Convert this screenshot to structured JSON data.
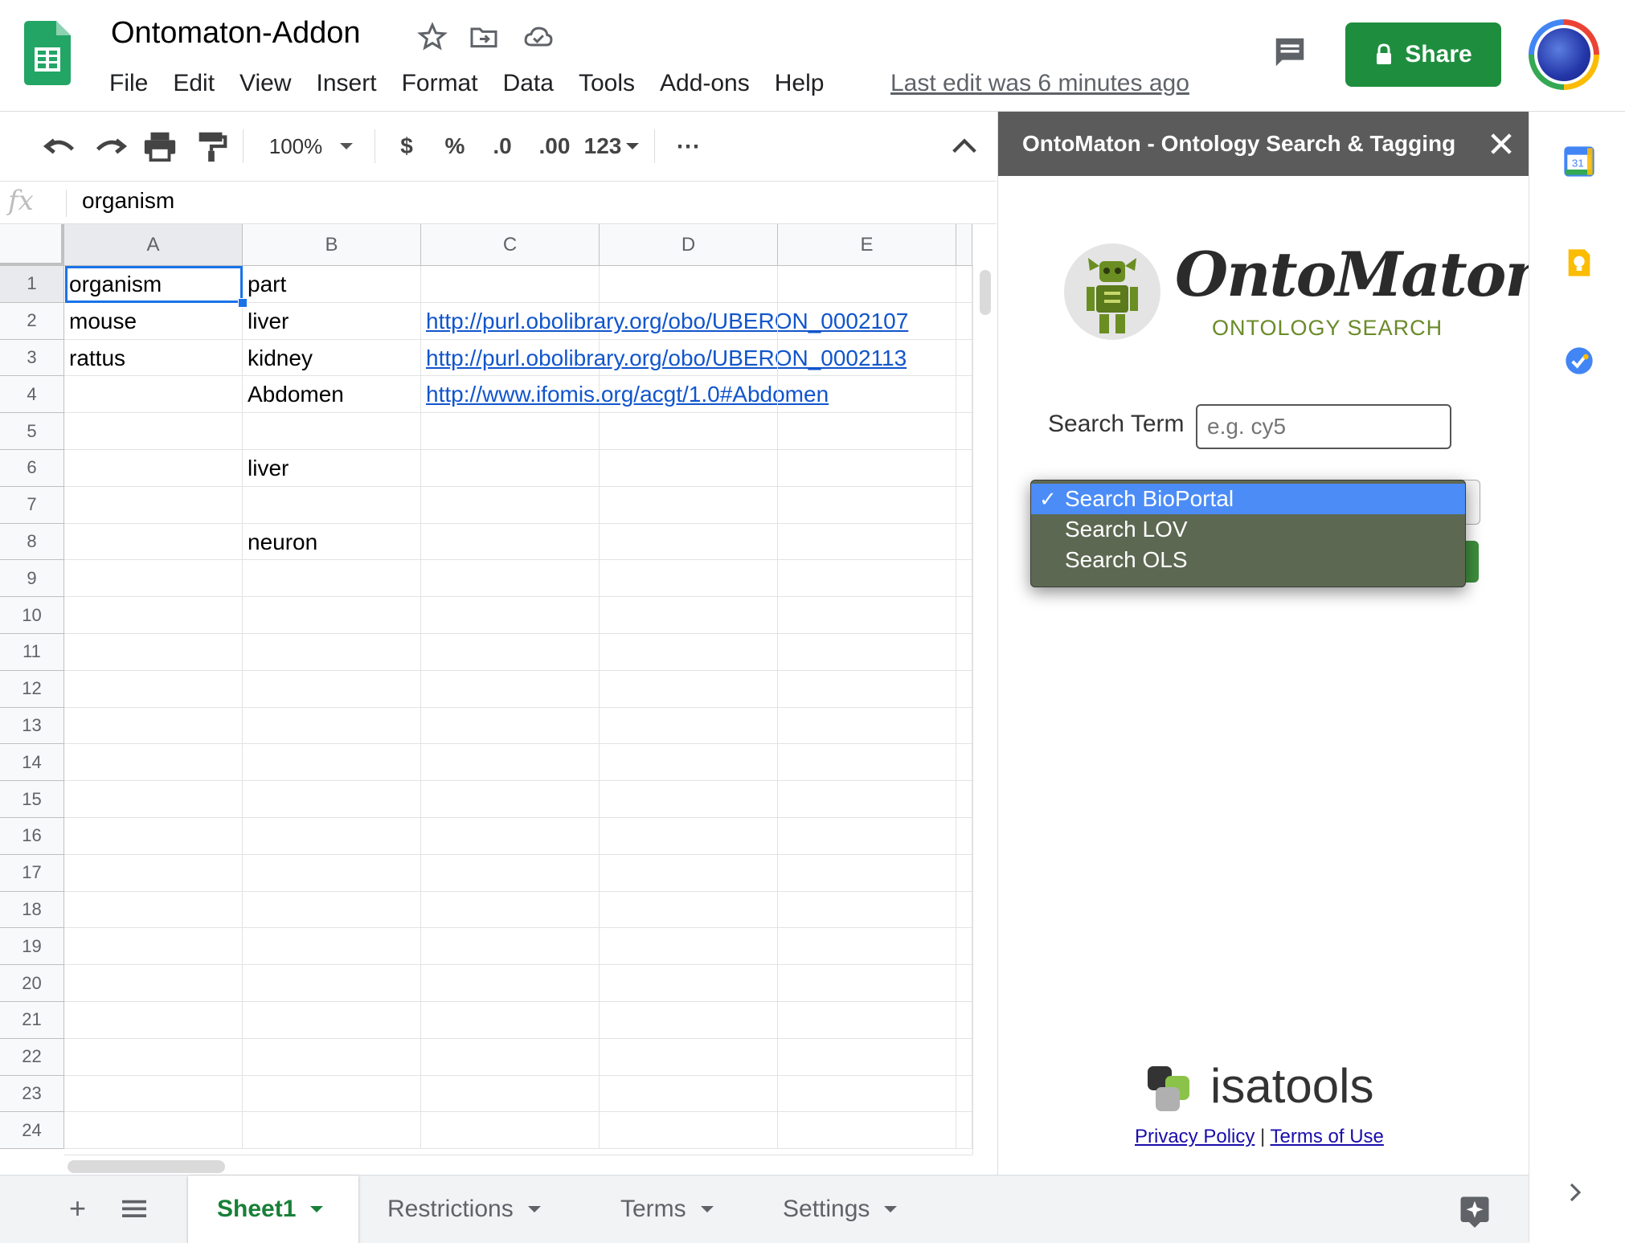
{
  "header": {
    "doc_title": "Ontomaton-Addon",
    "menu": [
      "File",
      "Edit",
      "View",
      "Insert",
      "Format",
      "Data",
      "Tools",
      "Add-ons",
      "Help"
    ],
    "last_edit": "Last edit was 6 minutes ago",
    "share_label": "Share"
  },
  "toolbar": {
    "zoom": "100%",
    "currency": "$",
    "percent": "%",
    "decimal_decrease": ".0",
    "decimal_increase": ".00",
    "format_more": "123",
    "more": "⋯"
  },
  "formula_bar": {
    "fx": "fx",
    "value": "organism"
  },
  "grid": {
    "columns": [
      "A",
      "B",
      "C",
      "D",
      "E"
    ],
    "rows": [
      "1",
      "2",
      "3",
      "4",
      "5",
      "6",
      "7",
      "8",
      "9",
      "10",
      "11",
      "12",
      "13",
      "14",
      "15",
      "16",
      "17",
      "18",
      "19",
      "20",
      "21",
      "22",
      "23",
      "24"
    ],
    "cells": {
      "A1": "organism",
      "B1": "part",
      "A2": "mouse",
      "B2": "liver",
      "C2": "http://purl.obolibrary.org/obo/UBERON_0002107",
      "A3": "rattus",
      "B3": "kidney",
      "C3": "http://purl.obolibrary.org/obo/UBERON_0002113",
      "B4": "Abdomen",
      "C4": "http://www.ifomis.org/acgt/1.0#Abdomen",
      "B6": "liver",
      "B8": "neuron"
    },
    "selected_cell": "A1"
  },
  "sheet_tabs": [
    "Sheet1",
    "Restrictions",
    "Terms",
    "Settings"
  ],
  "active_tab": "Sheet1",
  "addon_panel": {
    "title": "OntoMaton - Ontology Search & Tagging",
    "logo_title": "OntoMaton",
    "logo_subtitle": "ONTOLOGY SEARCH",
    "search_label": "Search Term",
    "search_placeholder": "e.g. cy5",
    "dropdown_options": [
      "Search BioPortal",
      "Search LOV",
      "Search OLS"
    ],
    "dropdown_selected": "Search BioPortal",
    "footer_brand": "isatools",
    "privacy_link": "Privacy Policy",
    "separator": "|",
    "terms_link": "Terms of Use"
  },
  "colors": {
    "share_green": "#1e8e3e",
    "link_blue": "#1155cc",
    "selection_blue": "#1a73e8",
    "panel_header": "#5b5b5b",
    "dropdown_highlight": "#4b8cf7"
  }
}
